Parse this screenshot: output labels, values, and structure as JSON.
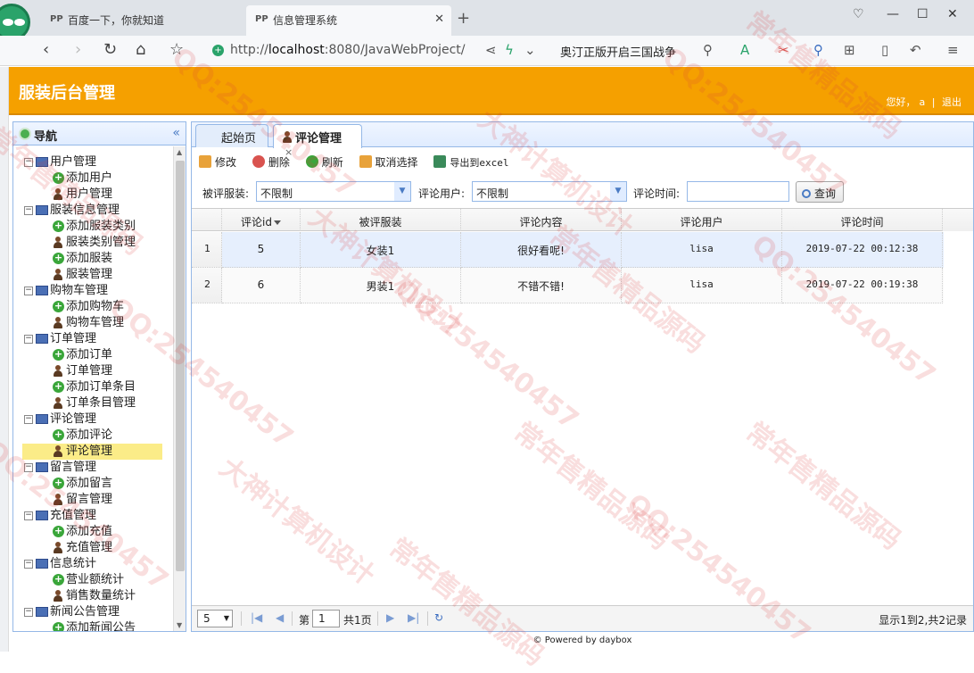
{
  "browser": {
    "tabs": [
      {
        "title": "百度一下，你就知道",
        "active": false
      },
      {
        "title": "信息管理系统",
        "active": true
      }
    ],
    "url_scheme": "http://",
    "url_host": "localhost",
    "url_rest": ":8080/JavaWebProject/",
    "search_hint": "奥汀正版开启三国战争"
  },
  "app": {
    "title": "服装后台管理",
    "greeting": "您好，",
    "user": "a",
    "separator": "|",
    "logout": "退出"
  },
  "sidebar": {
    "title": "导航",
    "collapse_glyph": "«",
    "groups": [
      {
        "label": "用户管理",
        "items": [
          {
            "label": "添加用户",
            "type": "add"
          },
          {
            "label": "用户管理",
            "type": "manage"
          }
        ]
      },
      {
        "label": "服装信息管理",
        "items": [
          {
            "label": "添加服装类别",
            "type": "add"
          },
          {
            "label": "服装类别管理",
            "type": "manage"
          },
          {
            "label": "添加服装",
            "type": "add"
          },
          {
            "label": "服装管理",
            "type": "manage"
          }
        ]
      },
      {
        "label": "购物车管理",
        "items": [
          {
            "label": "添加购物车",
            "type": "add"
          },
          {
            "label": "购物车管理",
            "type": "manage"
          }
        ]
      },
      {
        "label": "订单管理",
        "items": [
          {
            "label": "添加订单",
            "type": "add"
          },
          {
            "label": "订单管理",
            "type": "manage"
          },
          {
            "label": "添加订单条目",
            "type": "add"
          },
          {
            "label": "订单条目管理",
            "type": "manage"
          }
        ]
      },
      {
        "label": "评论管理",
        "items": [
          {
            "label": "添加评论",
            "type": "add"
          },
          {
            "label": "评论管理",
            "type": "manage",
            "selected": true
          }
        ]
      },
      {
        "label": "留言管理",
        "items": [
          {
            "label": "添加留言",
            "type": "add"
          },
          {
            "label": "留言管理",
            "type": "manage"
          }
        ]
      },
      {
        "label": "充值管理",
        "items": [
          {
            "label": "添加充值",
            "type": "add"
          },
          {
            "label": "充值管理",
            "type": "manage"
          }
        ]
      },
      {
        "label": "信息统计",
        "items": [
          {
            "label": "营业额统计",
            "type": "add"
          },
          {
            "label": "销售数量统计",
            "type": "manage"
          }
        ]
      },
      {
        "label": "新闻公告管理",
        "items": [
          {
            "label": "添加新闻公告",
            "type": "add"
          }
        ]
      }
    ]
  },
  "content": {
    "tabs": [
      {
        "label": "起始页",
        "active": false
      },
      {
        "label": "评论管理",
        "active": true,
        "close": "×"
      }
    ],
    "toolbar": [
      {
        "label": "修改",
        "icon": "pencil-icon",
        "color": "#e8a23a"
      },
      {
        "label": "删除",
        "icon": "delete-icon",
        "color": "#d9534f"
      },
      {
        "label": "刷新",
        "icon": "refresh-icon",
        "color": "#3aa63a"
      },
      {
        "label": "取消选择",
        "icon": "undo-icon",
        "color": "#e8a23a"
      },
      {
        "label": "导出到excel",
        "icon": "export-icon",
        "color": "#3a8a5a"
      }
    ],
    "filters": {
      "clothes_label": "被评服装:",
      "clothes_value": "不限制",
      "user_label": "评论用户:",
      "user_value": "不限制",
      "time_label": "评论时间:",
      "time_value": "",
      "query_label": "查询"
    },
    "grid": {
      "columns": [
        "评论id",
        "被评服装",
        "评论内容",
        "评论用户",
        "评论时间"
      ],
      "rows": [
        {
          "num": "1",
          "id": "5",
          "clothes": "女装1",
          "content": "很好看呢!",
          "user": "lisa",
          "time": "2019-07-22 00:12:38"
        },
        {
          "num": "2",
          "id": "6",
          "clothes": "男装1",
          "content": "不错不错!",
          "user": "lisa",
          "time": "2019-07-22 00:19:38"
        }
      ]
    },
    "pager": {
      "page_size": "5",
      "page_prefix": "第",
      "page_value": "1",
      "page_suffix": "共1页",
      "info": "显示1到2,共2记录"
    }
  },
  "footer": "© Powered by daybox",
  "watermark": {
    "texts": [
      "大神计算机设计",
      "QQ:254540457",
      "常年售精品源码"
    ]
  }
}
